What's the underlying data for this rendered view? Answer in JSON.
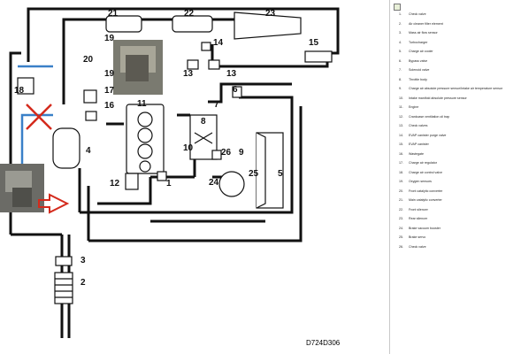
{
  "diagram": {
    "code": "D724D306",
    "callouts": [
      "1",
      "2",
      "3",
      "4",
      "5",
      "6",
      "7",
      "8",
      "9",
      "10",
      "11",
      "12",
      "13",
      "13",
      "14",
      "15",
      "16",
      "17",
      "18",
      "19",
      "19",
      "20",
      "21",
      "22",
      "23",
      "24",
      "25",
      "26"
    ]
  },
  "legend": {
    "items": [
      {
        "num": "1.",
        "label": "Check valve"
      },
      {
        "num": "2.",
        "label": "Air cleaner filter element"
      },
      {
        "num": "3.",
        "label": "Mass air flow sensor"
      },
      {
        "num": "4.",
        "label": "Turbocharger"
      },
      {
        "num": "5.",
        "label": "Charge air cooler"
      },
      {
        "num": "6.",
        "label": "Bypass valve"
      },
      {
        "num": "7.",
        "label": "Solenoid valve"
      },
      {
        "num": "8.",
        "label": "Throttle body"
      },
      {
        "num": "9.",
        "label": "Charge air absolute pressure sensor/Intake air temperature sensor"
      },
      {
        "num": "10.",
        "label": "Intake manifold absolute pressure sensor"
      },
      {
        "num": "11.",
        "label": "Engine"
      },
      {
        "num": "12.",
        "label": "Crankcase ventilation oil trap"
      },
      {
        "num": "13.",
        "label": "Check valves"
      },
      {
        "num": "14.",
        "label": "EVAP canister purge valve"
      },
      {
        "num": "15.",
        "label": "EVAP canister"
      },
      {
        "num": "16.",
        "label": "Wastegate"
      },
      {
        "num": "17.",
        "label": "Charge air regulator"
      },
      {
        "num": "18.",
        "label": "Charge air control valve"
      },
      {
        "num": "19.",
        "label": "Oxygen sensors"
      },
      {
        "num": "20.",
        "label": "Front catalytic converter"
      },
      {
        "num": "21.",
        "label": "Main catalytic converter"
      },
      {
        "num": "22.",
        "label": "Front silencer"
      },
      {
        "num": "23.",
        "label": "Rear silencer"
      },
      {
        "num": "24.",
        "label": "Brake vacuum booster"
      },
      {
        "num": "25.",
        "label": "Brake servo"
      },
      {
        "num": "26.",
        "label": "Check valve"
      }
    ]
  }
}
